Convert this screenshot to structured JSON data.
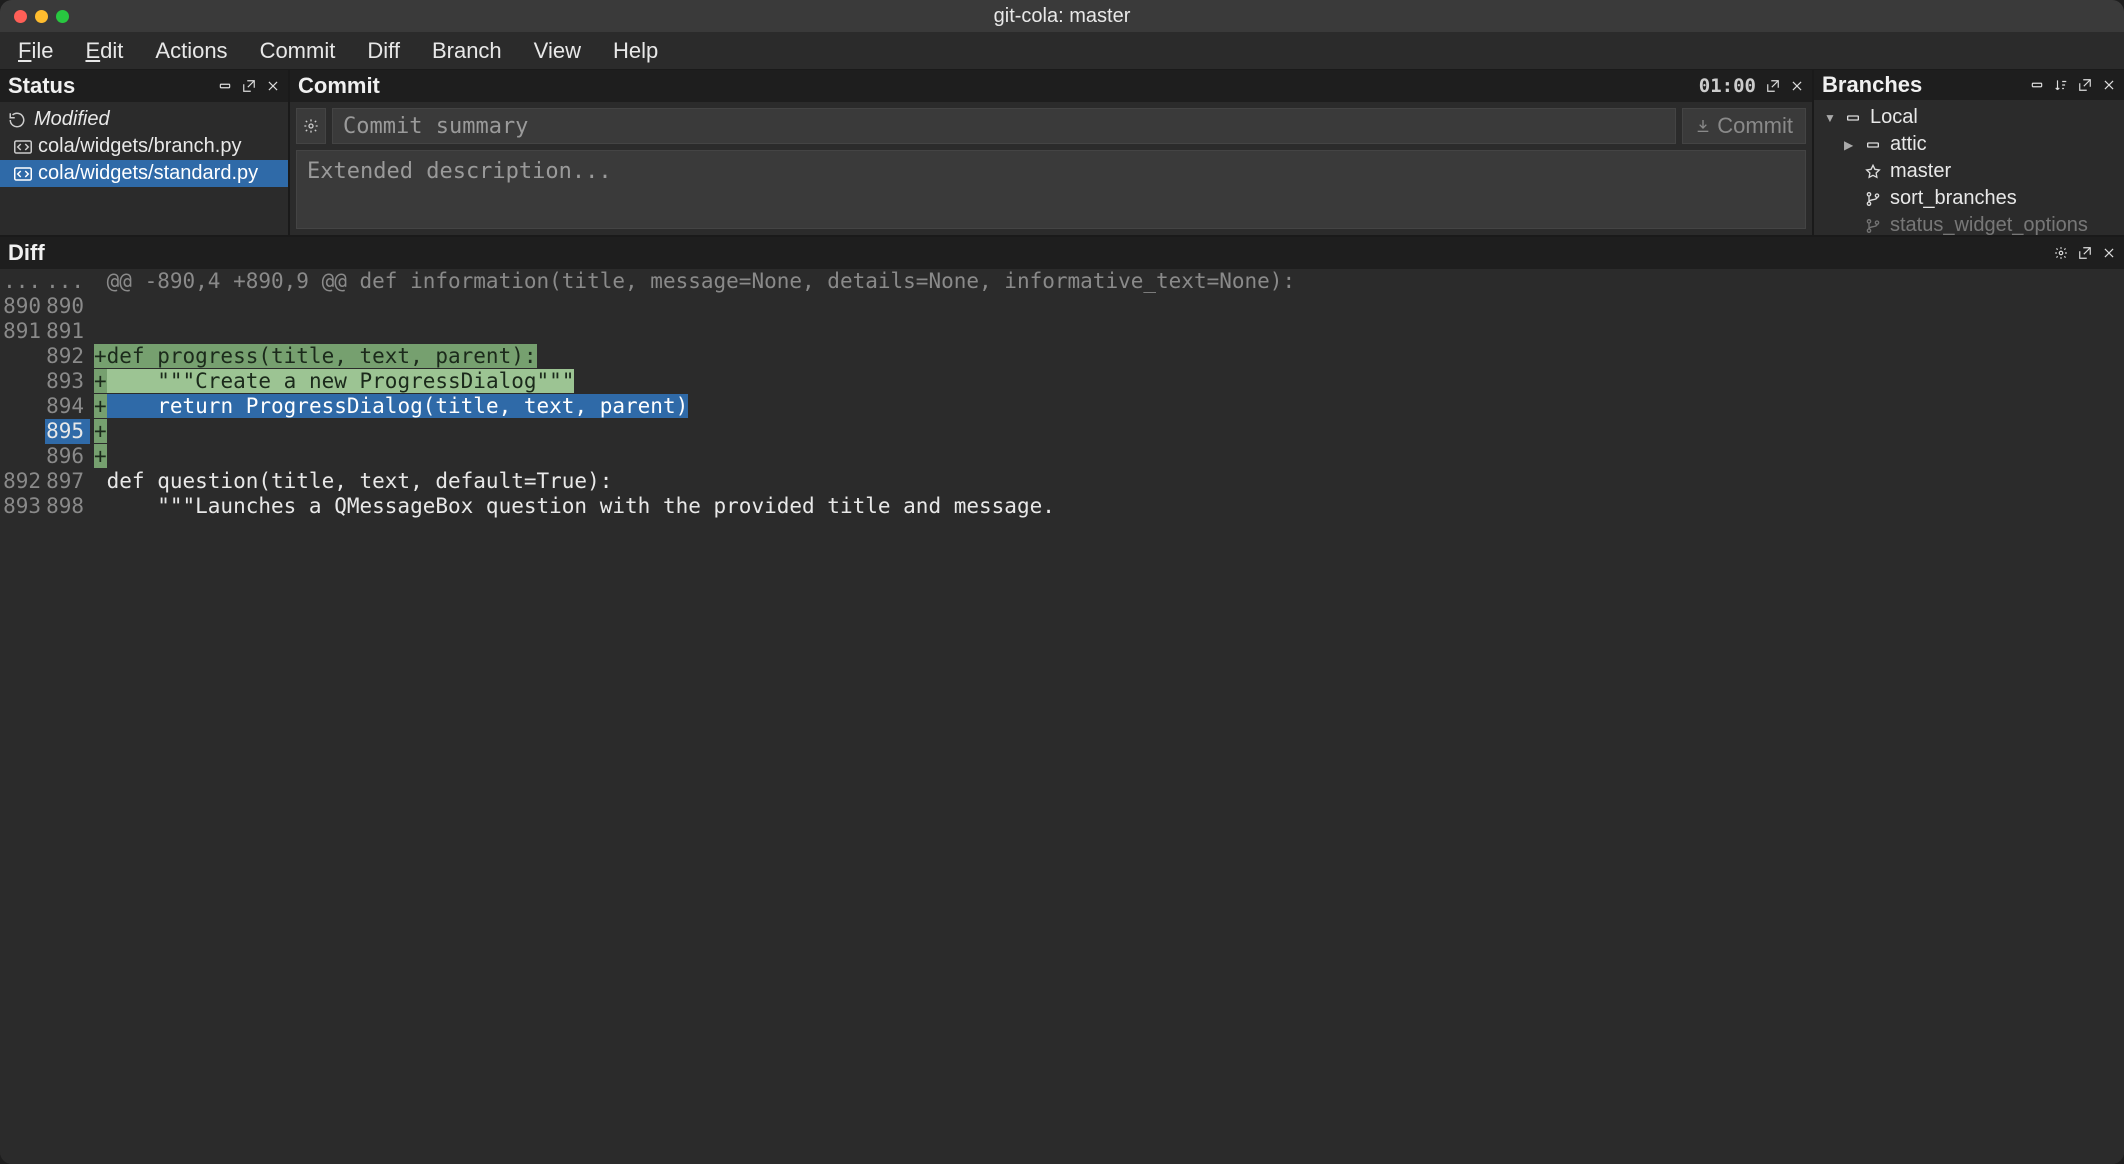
{
  "window": {
    "title": "git-cola: master"
  },
  "menubar": {
    "file": "File",
    "edit": "Edit",
    "actions": "Actions",
    "commit": "Commit",
    "diff": "Diff",
    "branch": "Branch",
    "view": "View",
    "help": "Help"
  },
  "status": {
    "title": "Status",
    "group_modified": "Modified",
    "files": [
      {
        "path": "cola/widgets/branch.py",
        "selected": false
      },
      {
        "path": "cola/widgets/standard.py",
        "selected": true
      }
    ]
  },
  "commit": {
    "title": "Commit",
    "timer": "01:00",
    "summary_placeholder": "Commit summary",
    "summary_value": "",
    "desc_placeholder": "Extended description...",
    "desc_value": "",
    "button_label": "Commit"
  },
  "branches": {
    "title": "Branches",
    "local_label": "Local",
    "items": [
      {
        "name": "attic",
        "icon": "folder",
        "expandable": true
      },
      {
        "name": "master",
        "icon": "star"
      },
      {
        "name": "sort_branches",
        "icon": "branch"
      },
      {
        "name": "status_widget_options",
        "icon": "branch"
      }
    ]
  },
  "diff": {
    "title": "Diff",
    "lines": [
      {
        "a": "...",
        "b": "...",
        "kind": "hunk",
        "text": " @@ -890,4 +890,9 @@ def information(title, message=None, details=None, informative_text=None):"
      },
      {
        "a": "890",
        "b": "890",
        "kind": "ctx",
        "text": ""
      },
      {
        "a": "891",
        "b": "891",
        "kind": "ctx",
        "text": ""
      },
      {
        "a": "",
        "b": "892",
        "kind": "add-def",
        "segA": "+def progress(title, text, parent):",
        "segB": ""
      },
      {
        "a": "",
        "b": "893",
        "kind": "add-doc",
        "segA": "+",
        "segB": "    \"\"\"Create a new ProgressDialog\"\"\""
      },
      {
        "a": "",
        "b": "894",
        "kind": "add-ret",
        "segA": "+",
        "segB": "    return ProgressDialog(title, text, parent)"
      },
      {
        "a": "",
        "b": "895",
        "kind": "add-blank-sel",
        "segA": "+",
        "segB": ""
      },
      {
        "a": "",
        "b": "896",
        "kind": "add-blank",
        "segA": "+",
        "segB": ""
      },
      {
        "a": "892",
        "b": "897",
        "kind": "ctx",
        "text": " def question(title, text, default=True):"
      },
      {
        "a": "893",
        "b": "898",
        "kind": "ctx",
        "text": "     \"\"\"Launches a QMessageBox question with the provided title and message."
      }
    ]
  }
}
